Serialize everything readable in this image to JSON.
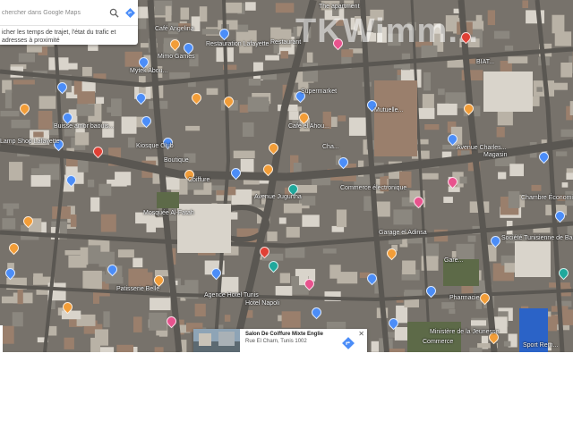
{
  "search": {
    "placeholder": "chercher dans Google Maps",
    "hint": "icher les temps de trajet, l'état du trafic et adresses à proximité"
  },
  "watermark": "TKWimm...",
  "poi_labels": [
    "Café Angelina",
    "The apartment",
    "Mimo Games",
    "Restauration Lafayette",
    "Mytek Abou...",
    "Supermarket",
    "Café el Ahou...",
    "Buisse amor baouis...",
    "Kiosque Club",
    "Lamp Shop Lafayette",
    "Boutique",
    "Cha...",
    "Avenue Jugurtha",
    "Magasin",
    "Mosquée Al-Fatah",
    "Garage el Adinsa",
    "Gare...",
    "Patisserie Belle",
    "Agence Hotel Tunis",
    "Hotel Napoli",
    "Pharmacie",
    "Ministère de la Jeunesse",
    "Commerce",
    "Sport Rem...",
    "Chambre Économique Tuniso Européenne",
    "Société Tunisienne de Banque",
    "Avenue Charles...",
    "BIAT...",
    "Restaurant",
    "Coiffure",
    "Mutuelle...",
    "Commerce électronique"
  ],
  "place_card": {
    "name": "Salon De Coiffure Mixte Englie",
    "address": "Rue El Charn, Tunis 1002"
  },
  "icons": {
    "search": "search-icon",
    "directions": "directions-icon",
    "close": "close-icon"
  },
  "colors": {
    "pin_orange": "#f29d38",
    "pin_blue": "#4b8df8",
    "pin_pink": "#e8528d",
    "directions_blue": "#4b8df8"
  }
}
